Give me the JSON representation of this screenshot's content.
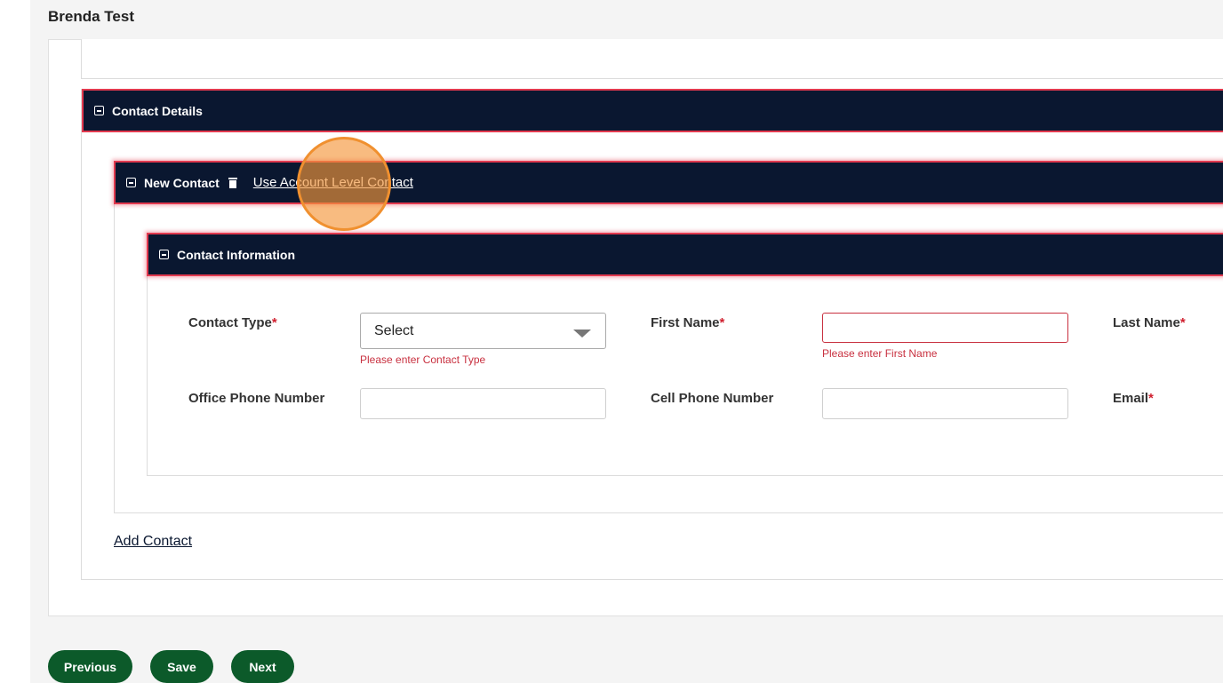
{
  "header": {
    "title": "Brenda Test"
  },
  "sections": {
    "contact_details": {
      "title": "Contact Details"
    },
    "new_contact": {
      "title": "New Contact",
      "use_account_link": "Use Account Level Contact"
    },
    "contact_information": {
      "title": "Contact Information"
    }
  },
  "form": {
    "contact_type": {
      "label": "Contact Type",
      "required_mark": "*",
      "value": "Select",
      "error": "Please enter Contact Type"
    },
    "first_name": {
      "label": "First Name",
      "required_mark": "*",
      "value": "",
      "error": "Please enter First Name"
    },
    "last_name": {
      "label": "Last Name",
      "required_mark": "*"
    },
    "office_phone": {
      "label": "Office Phone Number",
      "value": ""
    },
    "cell_phone": {
      "label": "Cell Phone Number",
      "value": ""
    },
    "email": {
      "label": "Email",
      "required_mark": "*"
    }
  },
  "add_contact_label": "Add Contact",
  "buttons": {
    "previous": "Previous",
    "save": "Save",
    "next": "Next"
  },
  "colors": {
    "bar_bg": "#0a1730",
    "bar_border": "#e23a4f",
    "button_green": "#0c5a2a",
    "error_red": "#c8303f"
  }
}
